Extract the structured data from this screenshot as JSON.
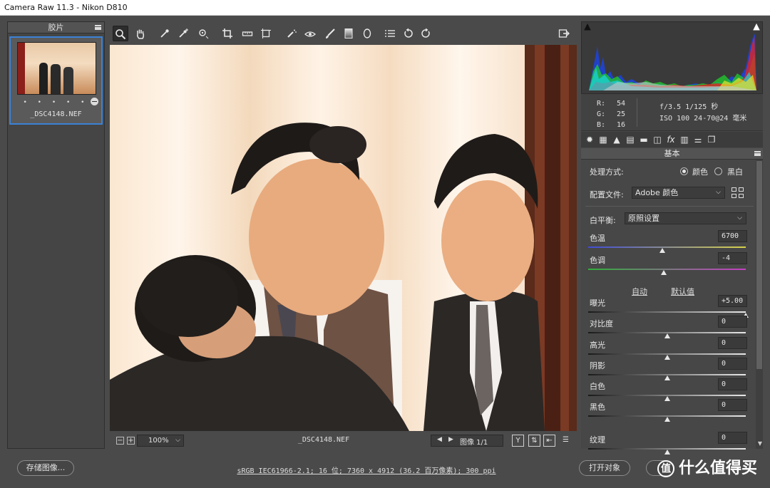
{
  "window": {
    "title": "Camera Raw 11.3 -  Nikon D810"
  },
  "filmstrip": {
    "header": "胶片",
    "items": [
      {
        "name": "_DSC4148.NEF",
        "rating_dots": "• • • • •"
      }
    ]
  },
  "toolbar": {
    "tools": [
      {
        "name": "zoom-tool",
        "glyph": "magnifier"
      },
      {
        "name": "hand-tool",
        "glyph": "hand"
      },
      {
        "name": "white-balance-tool",
        "glyph": "eyedropper"
      },
      {
        "name": "color-sampler-tool",
        "glyph": "eyedropper-plus"
      },
      {
        "name": "targeted-adjustment-tool",
        "glyph": "target"
      },
      {
        "name": "crop-tool",
        "glyph": "crop"
      },
      {
        "name": "straighten-tool",
        "glyph": "level"
      },
      {
        "name": "transform-tool",
        "glyph": "transform"
      },
      {
        "name": "spot-removal-tool",
        "glyph": "brush-spot"
      },
      {
        "name": "red-eye-tool",
        "glyph": "eye"
      },
      {
        "name": "adjustment-brush-tool",
        "glyph": "brush"
      },
      {
        "name": "graduated-filter-tool",
        "glyph": "gradient"
      },
      {
        "name": "radial-filter-tool",
        "glyph": "ellipse"
      },
      {
        "name": "preferences-tool",
        "glyph": "list"
      },
      {
        "name": "rotate-left-tool",
        "glyph": "rotate-ccw"
      },
      {
        "name": "rotate-right-tool",
        "glyph": "rotate-cw"
      }
    ],
    "fullscreen_icon": "export-icon"
  },
  "image_bar": {
    "zoom": "100%",
    "filename": "_DSC4148.NEF",
    "page_label": "图像 1/1"
  },
  "readout": {
    "r_label": "R:",
    "r_value": "54",
    "g_label": "G:",
    "g_value": "25",
    "b_label": "B:",
    "b_value": "16",
    "exif_line1": "f/3.5  1/125 秒",
    "exif_line2": "ISO 100  24-70@24 毫米"
  },
  "panel": {
    "title": "基本",
    "treatment_label": "处理方式:",
    "color_label": "颜色",
    "bw_label": "黑白",
    "profile_label": "配置文件:",
    "profile_value": "Adobe 颜色",
    "wb_label": "白平衡:",
    "wb_value": "原照设置",
    "auto_label": "自动",
    "default_label": "默认值",
    "sliders": [
      {
        "label": "色温",
        "value": "6700",
        "position": 0.47
      },
      {
        "label": "色调",
        "value": "-4",
        "position": 0.48
      },
      {
        "label": "曝光",
        "value": "+5.00",
        "position": 1.0
      },
      {
        "label": "对比度",
        "value": "0",
        "position": 0.5
      },
      {
        "label": "高光",
        "value": "0",
        "position": 0.5
      },
      {
        "label": "阴影",
        "value": "0",
        "position": 0.5
      },
      {
        "label": "白色",
        "value": "0",
        "position": 0.5
      },
      {
        "label": "黑色",
        "value": "0",
        "position": 0.5
      },
      {
        "label": "纹理",
        "value": "0",
        "position": 0.5
      }
    ]
  },
  "footer": {
    "save_button": "存储图像...",
    "info": "sRGB IEC61966-2.1; 16 位; 7360 x 4912 (36.2 百万像素); 300 ppi",
    "open_button": "打开对象",
    "watermark": "什么值得买",
    "watermark_glyph": "值"
  },
  "colors": {
    "accent": "#3b82d6",
    "temp_track": [
      "#3f4bd6",
      "#d8d24a"
    ],
    "tint_track": [
      "#2fb03a",
      "#c43fc4"
    ]
  }
}
